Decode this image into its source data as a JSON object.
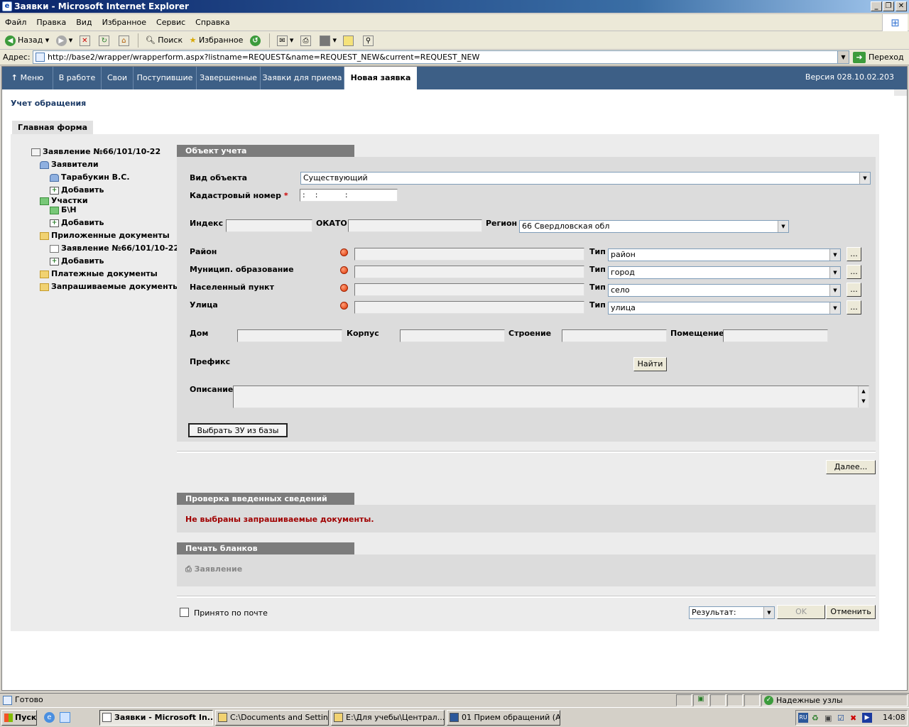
{
  "window": {
    "title": "Заявки - Microsoft Internet Explorer"
  },
  "menu": [
    "Файл",
    "Правка",
    "Вид",
    "Избранное",
    "Сервис",
    "Справка"
  ],
  "toolbar": {
    "back": "Назад",
    "search": "Поиск",
    "favorites": "Избранное"
  },
  "address": {
    "label": "Адрес:",
    "url": "http://base2/wrapper/wrapperform.aspx?listname=REQUEST&name=REQUEST_NEW&current=REQUEST_NEW",
    "go": "Переход"
  },
  "app_tabs": [
    "Меню",
    "В работе",
    "Свои",
    "Поступившие",
    "Завершенные",
    "Заявки для приема",
    "Новая заявка"
  ],
  "version": "Версия 028.10.02.203",
  "page_title": "Учет обращения",
  "form_tab": "Главная форма",
  "tree": {
    "root": "Заявление №66/101/10-22",
    "applicants": "Заявители",
    "applicant_1": "Тарабукин В.С.",
    "add_1": "Добавить",
    "plots": "Участки",
    "plot_1": "Б\\Н",
    "add_2": "Добавить",
    "attached_docs": "Приложенные документы",
    "attached_1": "Заявление №66/101/10-22",
    "add_3": "Добавить",
    "payment_docs": "Платежные документы",
    "requested_docs": "Запрашиваемые документы"
  },
  "object": {
    "header": "Объект учета",
    "type_label": "Вид объекта",
    "type_value": "Существующий",
    "cadastral_label": "Кадастровый номер",
    "required_mark": "*",
    "cadastral_mask": ":    :           :",
    "index_label": "Индекс",
    "okato_label": "ОКАТО",
    "region_label": "Регион",
    "region_value": "66 Свердловская обл",
    "district_label": "Район",
    "municipal_label": "Муницип. образование",
    "settlement_label": "Населенный пункт",
    "street_label": "Улица",
    "type_short": "Тип",
    "district_type": "район",
    "municipal_type": "город",
    "settlement_type": "село",
    "street_type": "улица",
    "ellipsis": "...",
    "house_label": "Дом",
    "building_label": "Корпус",
    "structure_label": "Строение",
    "room_label": "Помещение",
    "prefix_label": "Префикс",
    "find_button": "Найти",
    "description_label": "Описание",
    "select_button": "Выбрать ЗУ из базы"
  },
  "next_button": "Далее...",
  "check": {
    "header": "Проверка введенных сведений",
    "message": "Не выбраны запрашиваемые документы."
  },
  "print": {
    "header": "Печать бланков",
    "item": "Заявление"
  },
  "footer": {
    "received_by_mail": "Принято по почте",
    "result_placeholder": "Результат:",
    "ok": "OK",
    "cancel": "Отменить"
  },
  "status": {
    "ready": "Готово",
    "zone": "Надежные узлы"
  },
  "taskbar": {
    "start": "Пуск",
    "items": [
      "Заявки - Microsoft In...",
      "C:\\Documents and Settin...",
      "E:\\Для учебы\\Централ...",
      "01 Прием обращений (А..."
    ],
    "lang": "RU",
    "clock": "14:08"
  },
  "colors": {
    "nav_bar": "#3d5f86",
    "section_header": "#7c7c7c",
    "warning_text": "#a00000",
    "title_text": "#1b3a66"
  }
}
